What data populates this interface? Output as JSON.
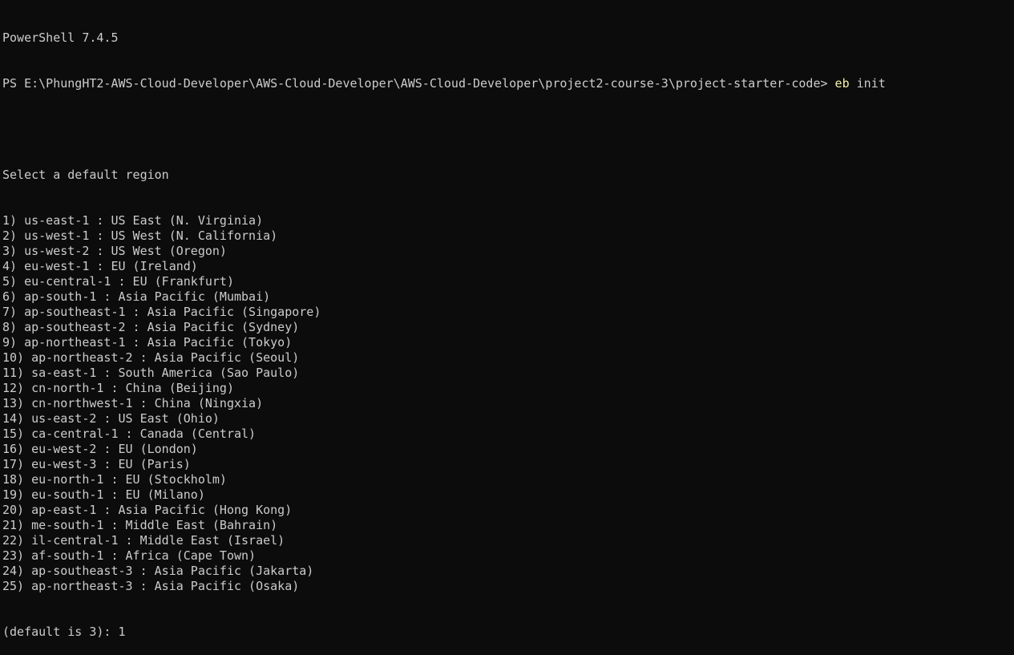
{
  "shell": {
    "banner": "PowerShell 7.4.5",
    "prompt": "PS E:\\PhungHT2-AWS-Cloud-Developer\\AWS-Cloud-Developer\\AWS-Cloud-Developer\\project2-course-3\\project-starter-code> ",
    "command": "eb",
    "command_args": " init"
  },
  "region_menu": {
    "heading": "Select a default region",
    "options": [
      "1) us-east-1 : US East (N. Virginia)",
      "2) us-west-1 : US West (N. California)",
      "3) us-west-2 : US West (Oregon)",
      "4) eu-west-1 : EU (Ireland)",
      "5) eu-central-1 : EU (Frankfurt)",
      "6) ap-south-1 : Asia Pacific (Mumbai)",
      "7) ap-southeast-1 : Asia Pacific (Singapore)",
      "8) ap-southeast-2 : Asia Pacific (Sydney)",
      "9) ap-northeast-1 : Asia Pacific (Tokyo)",
      "10) ap-northeast-2 : Asia Pacific (Seoul)",
      "11) sa-east-1 : South America (Sao Paulo)",
      "12) cn-north-1 : China (Beijing)",
      "13) cn-northwest-1 : China (Ningxia)",
      "14) us-east-2 : US East (Ohio)",
      "15) ca-central-1 : Canada (Central)",
      "16) eu-west-2 : EU (London)",
      "17) eu-west-3 : EU (Paris)",
      "18) eu-north-1 : EU (Stockholm)",
      "19) eu-south-1 : EU (Milano)",
      "20) ap-east-1 : Asia Pacific (Hong Kong)",
      "21) me-south-1 : Middle East (Bahrain)",
      "22) il-central-1 : Middle East (Israel)",
      "23) af-south-1 : Africa (Cape Town)",
      "24) ap-southeast-3 : Asia Pacific (Jakarta)",
      "25) ap-northeast-3 : Asia Pacific (Osaka)"
    ],
    "input_prompt": "(default is 3): ",
    "input_value": "1"
  }
}
